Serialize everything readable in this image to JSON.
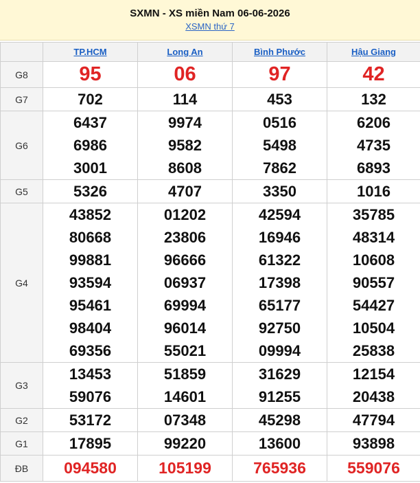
{
  "header": {
    "title": "SXMN - XS miền Nam 06-06-2026",
    "sub_link": "XSMN thứ 7"
  },
  "provinces": [
    "TP.HCM",
    "Long An",
    "Bình Phước",
    "Hậu Giang"
  ],
  "prizes": [
    {
      "label": "G8",
      "values": [
        [
          "95"
        ],
        [
          "06"
        ],
        [
          "97"
        ],
        [
          "42"
        ]
      ]
    },
    {
      "label": "G7",
      "values": [
        [
          "702"
        ],
        [
          "114"
        ],
        [
          "453"
        ],
        [
          "132"
        ]
      ]
    },
    {
      "label": "G6",
      "values": [
        [
          "6437",
          "6986",
          "3001"
        ],
        [
          "9974",
          "9582",
          "8608"
        ],
        [
          "0516",
          "5498",
          "7862"
        ],
        [
          "6206",
          "4735",
          "6893"
        ]
      ]
    },
    {
      "label": "G5",
      "values": [
        [
          "5326"
        ],
        [
          "4707"
        ],
        [
          "3350"
        ],
        [
          "1016"
        ]
      ]
    },
    {
      "label": "G4",
      "values": [
        [
          "43852",
          "80668",
          "99881",
          "93594",
          "95461",
          "98404",
          "69356"
        ],
        [
          "01202",
          "23806",
          "96666",
          "06937",
          "69994",
          "96014",
          "55021"
        ],
        [
          "42594",
          "16946",
          "61322",
          "17398",
          "65177",
          "92750",
          "09994"
        ],
        [
          "35785",
          "48314",
          "10608",
          "90557",
          "54427",
          "10504",
          "25838"
        ]
      ]
    },
    {
      "label": "G3",
      "values": [
        [
          "13453",
          "59076"
        ],
        [
          "51859",
          "14601"
        ],
        [
          "31629",
          "91255"
        ],
        [
          "12154",
          "20438"
        ]
      ]
    },
    {
      "label": "G2",
      "values": [
        [
          "53172"
        ],
        [
          "07348"
        ],
        [
          "45298"
        ],
        [
          "47794"
        ]
      ]
    },
    {
      "label": "G1",
      "values": [
        [
          "17895"
        ],
        [
          "99220"
        ],
        [
          "13600"
        ],
        [
          "93898"
        ]
      ]
    },
    {
      "label": "ĐB",
      "values": [
        [
          "094580"
        ],
        [
          "105199"
        ],
        [
          "765936"
        ],
        [
          "559076"
        ]
      ]
    }
  ],
  "colors": {
    "accent_red": "#e02424",
    "link_blue": "#1a5fc4",
    "header_bg": "#fff8d6"
  }
}
